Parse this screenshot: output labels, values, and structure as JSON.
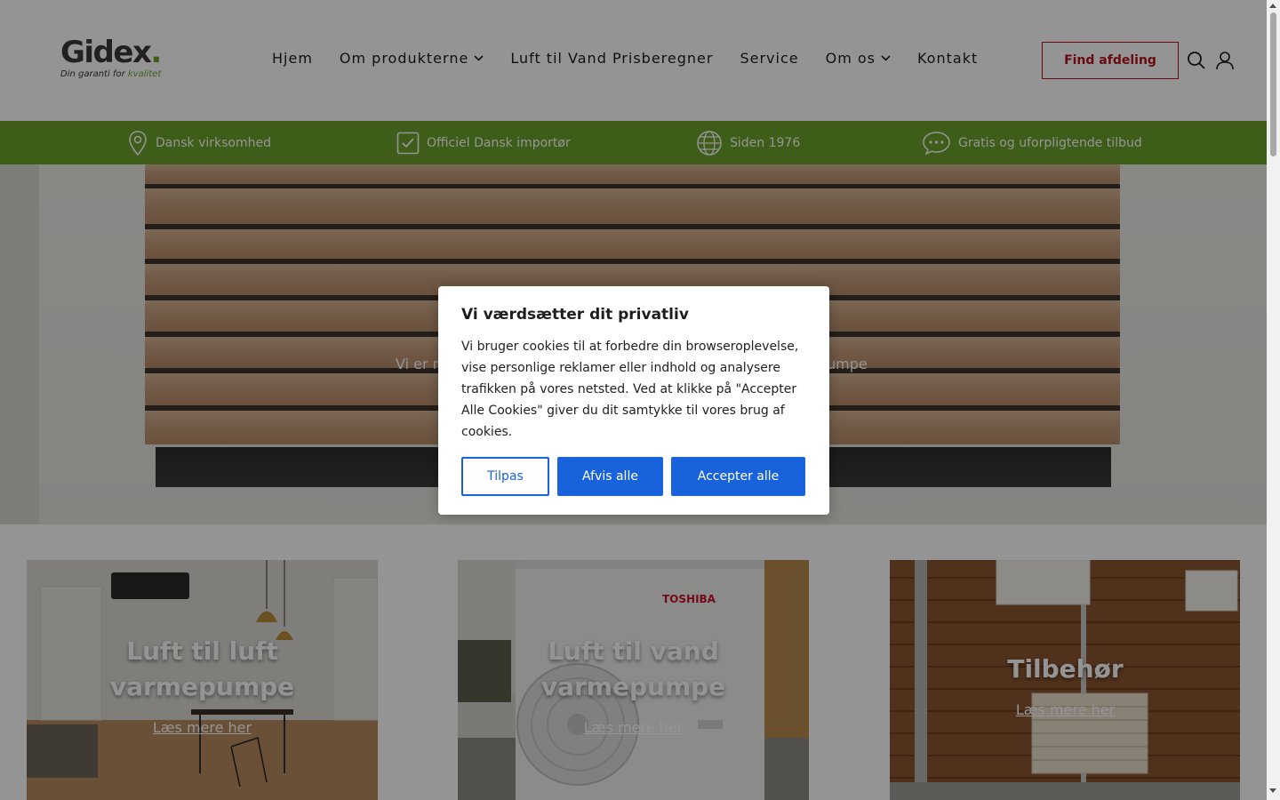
{
  "header": {
    "logo": {
      "word_main": "Gidex",
      "word_dot": ".",
      "tagline_main": "Din garanti for ",
      "tagline_accent": "kvalitet"
    },
    "nav": [
      {
        "label": "Hjem",
        "has_dropdown": false
      },
      {
        "label": "Om produkterne",
        "has_dropdown": true
      },
      {
        "label": "Luft til Vand Prisberegner",
        "has_dropdown": false
      },
      {
        "label": "Service",
        "has_dropdown": false
      },
      {
        "label": "Om os",
        "has_dropdown": true
      },
      {
        "label": "Kontakt",
        "has_dropdown": false
      }
    ],
    "find_button": "Find afdeling",
    "icons": [
      "search-icon",
      "user-icon"
    ]
  },
  "usp_bar": {
    "color": "#6aa12b",
    "items": [
      {
        "icon": "location-pin-icon",
        "label": "Dansk virksomhed"
      },
      {
        "icon": "checkbox-icon",
        "label": "Officiel Dansk importør"
      },
      {
        "icon": "globe-icon",
        "label": "Siden 1976"
      },
      {
        "icon": "chat-bubble-icon",
        "label": "Gratis og uforpligtende tilbud"
      }
    ]
  },
  "hero": {
    "text_left_visible": "Vi er n",
    "text_right_visible": "umpe"
  },
  "cards": [
    {
      "title_line1": "Luft til luft",
      "title_line2": "varmepumpe",
      "link": "Læs mere her"
    },
    {
      "title_line1": "Luft til vand",
      "title_line2": "varmepumpe",
      "link": "Læs mere her",
      "brand_on_image": "TOSHIBA"
    },
    {
      "title_line1": "Tilbehør",
      "link": "Læs mere her"
    }
  ],
  "cookie_dialog": {
    "title": "Vi værdsætter dit privatliv",
    "body": "Vi bruger cookies til at forbedre din browseroplevelse, vise personlige reklamer eller indhold og analysere trafikken på vores netsted. Ved at klikke på \"Accepter Alle Cookies\" giver du dit samtykke til vores brug af cookies.",
    "buttons": {
      "customize": "Tilpas",
      "reject": "Afvis alle",
      "accept": "Accepter alle"
    },
    "accent_color": "#1863dc"
  },
  "colors": {
    "brand_green": "#6aa12b",
    "brand_red": "#b5121b"
  }
}
